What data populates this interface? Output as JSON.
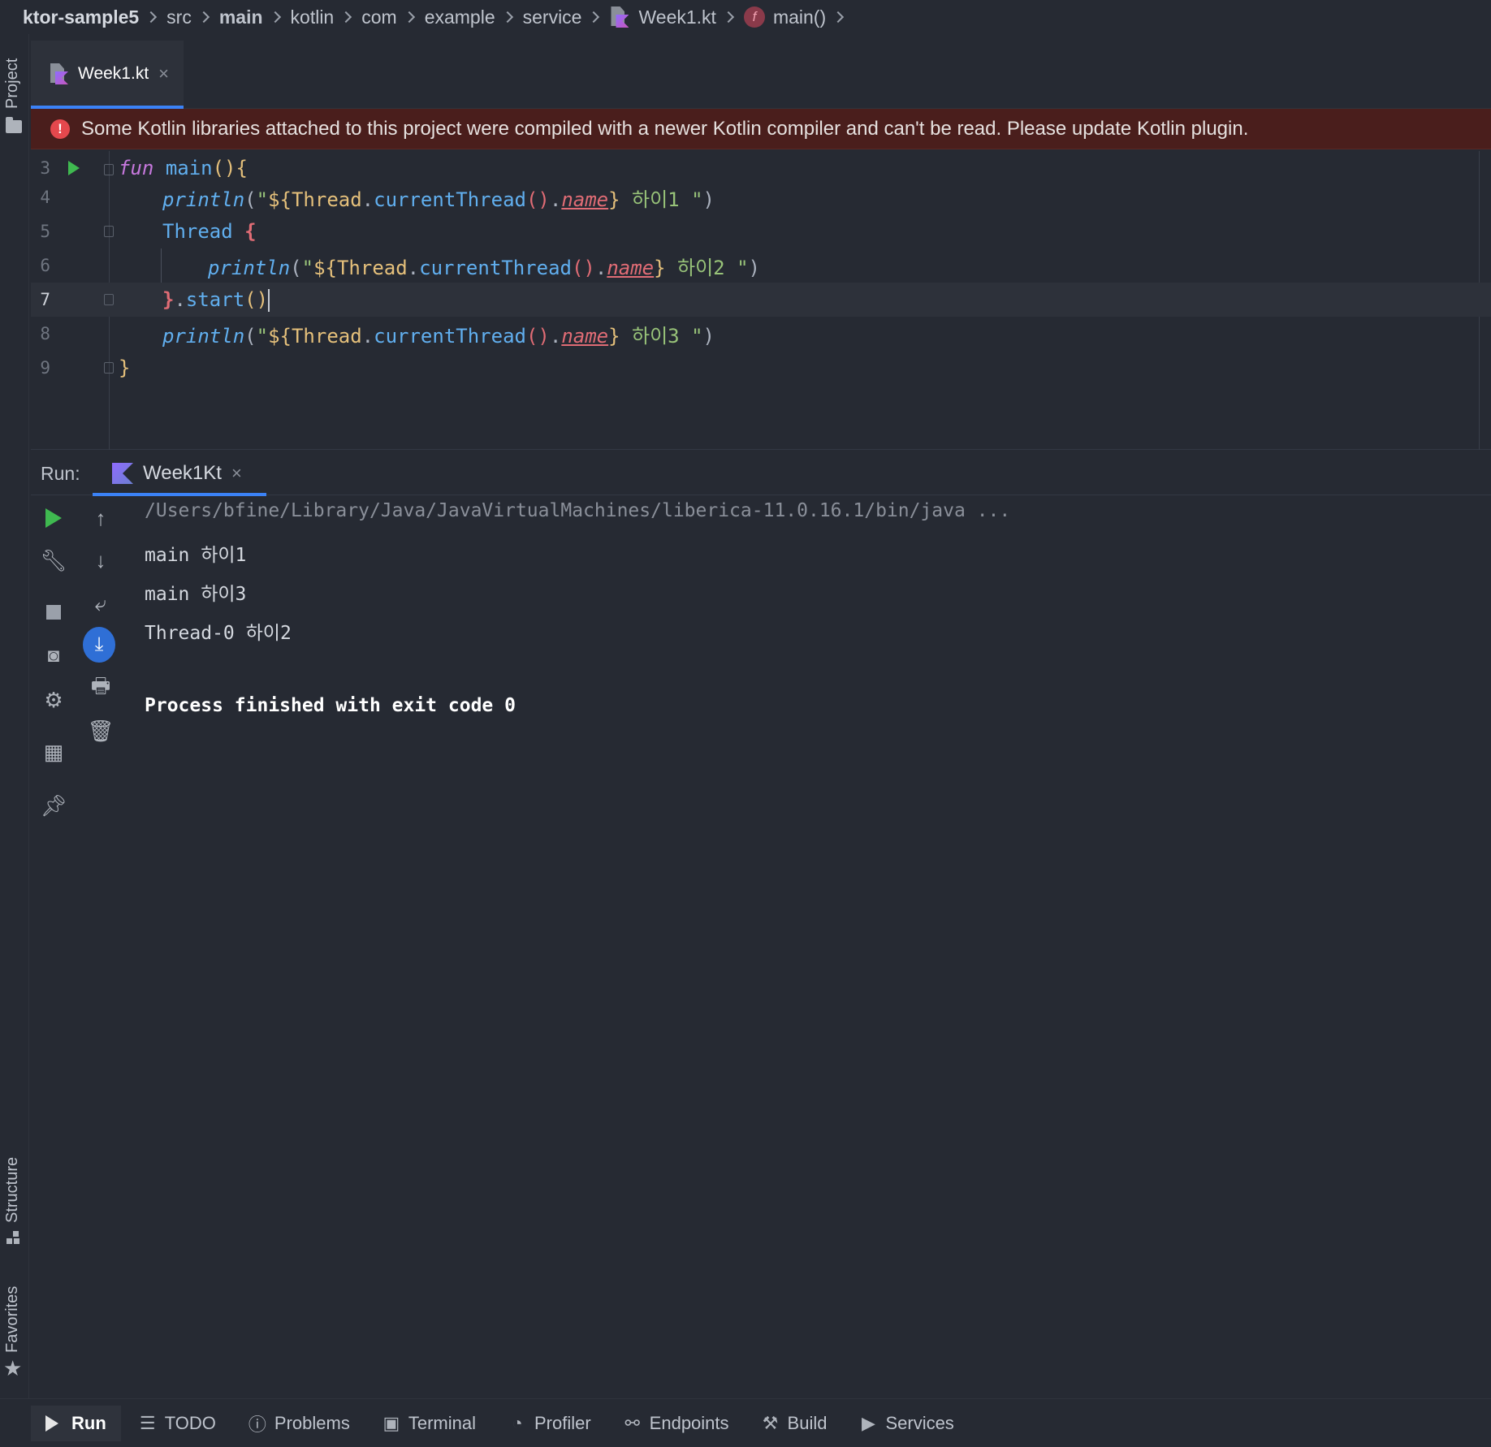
{
  "breadcrumb": {
    "items": [
      "ktor-sample5",
      "src",
      "main",
      "kotlin",
      "com",
      "example",
      "service",
      "Week1.kt",
      "main()"
    ]
  },
  "left_stripe": {
    "project_label": "Project",
    "structure_label": "Structure",
    "favorites_label": "Favorites"
  },
  "editor": {
    "tab_label": "Week1.kt",
    "banner_text": "Some Kotlin libraries attached to this project were compiled with a newer Kotlin compiler and can't be read. Please update Kotlin plugin.",
    "line_numbers": [
      "3",
      "4",
      "5",
      "6",
      "7",
      "8",
      "9"
    ],
    "current_line": "7",
    "code": {
      "l3_kw": "fun",
      "l3_name": "main",
      "l3_rest": "(){",
      "hello_fn": "println",
      "thread_cls": "Thread",
      "current_thread_fn": "currentThread",
      "name_prop": "name",
      "l4_msg": " 하이1 ",
      "l6_msg": " 하이2 ",
      "l8_msg": " 하이3 ",
      "l7_start": "start",
      "l9_brace": "}"
    }
  },
  "run_panel": {
    "label": "Run:",
    "tab_label": "Week1Kt",
    "console": [
      "/Users/bfine/Library/Java/JavaVirtualMachines/liberica-11.0.16.1/bin/java ...",
      "main 하이1",
      "main 하이3",
      "Thread-0 하이2",
      "",
      "Process finished with exit code 0"
    ]
  },
  "bottom_bar": {
    "items": [
      "Run",
      "TODO",
      "Problems",
      "Terminal",
      "Profiler",
      "Endpoints",
      "Build",
      "Services"
    ]
  },
  "colors": {
    "background": "#262a33",
    "accent": "#3b82f6",
    "error": "#e5484d",
    "banner": "#4a1e1c",
    "run_green": "#3fb950"
  }
}
